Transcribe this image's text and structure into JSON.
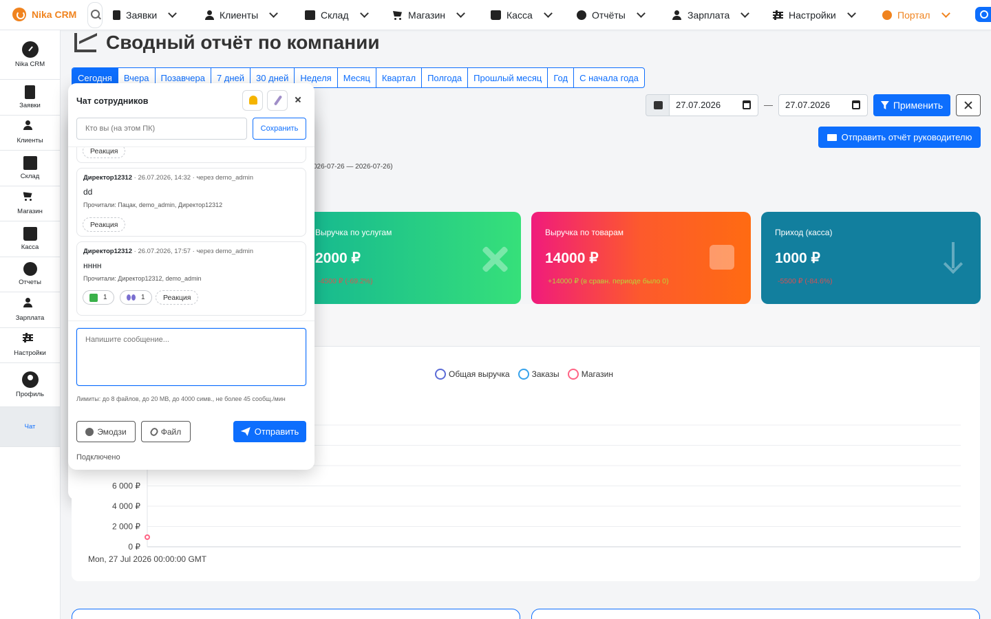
{
  "brand": {
    "name": "Nika CRM",
    "accent": "#f0831e"
  },
  "nav": [
    {
      "label": "Заявки",
      "icon": "document-icon"
    },
    {
      "label": "Клиенты",
      "icon": "users-icon"
    },
    {
      "label": "Склад",
      "icon": "boxes-icon"
    },
    {
      "label": "Магазин",
      "icon": "cart-icon"
    },
    {
      "label": "Касса",
      "icon": "cash-register-icon"
    },
    {
      "label": "Отчёты",
      "icon": "pie-chart-icon"
    },
    {
      "label": "Зарплата",
      "icon": "user-tie-icon"
    },
    {
      "label": "Настройки",
      "icon": "sliders-icon"
    },
    {
      "label": "Портал",
      "icon": "portal-icon"
    }
  ],
  "sidebar": [
    {
      "label": "Nika CRM",
      "icon": "dashboard-gauge-icon"
    },
    {
      "label": "Заявки",
      "icon": "document-icon"
    },
    {
      "label": "Клиенты",
      "icon": "users-icon"
    },
    {
      "label": "Склад",
      "icon": "boxes-icon"
    },
    {
      "label": "Магазин",
      "icon": "cart-icon"
    },
    {
      "label": "Касса",
      "icon": "cash-register-icon"
    },
    {
      "label": "Отчеты",
      "icon": "pie-chart-icon"
    },
    {
      "label": "Зарплата",
      "icon": "user-tie-icon"
    },
    {
      "label": "Настройки",
      "icon": "sliders-icon"
    },
    {
      "label": "Профиль",
      "icon": "avatar-icon"
    },
    {
      "label": "Чат",
      "icon": "chat-icon"
    }
  ],
  "page": {
    "title": "Сводный отчёт по компании"
  },
  "periods": [
    "Сегодня",
    "Вчера",
    "Позавчера",
    "7 дней",
    "30 дней",
    "Неделя",
    "Месяц",
    "Квартал",
    "Полгода",
    "Прошлый месяц",
    "Год",
    "С начала года"
  ],
  "filters": {
    "date_from": "27.07.2026",
    "date_to": "27.07.2026",
    "separator": "—",
    "apply": "Применить",
    "send_report": "Отправить отчёт руководителю",
    "range_note": "026-07-26 — 2026-07-26)"
  },
  "cards": [
    {
      "title": "Выручка по услугам",
      "value": "2000 ₽",
      "delta": "-4500 ₽ (-69.2%)",
      "icon": "tools-icon"
    },
    {
      "title": "Выручка по товарам",
      "value": "14000 ₽",
      "delta": "+14000 ₽ (в сравн. периоде было 0)",
      "icon": "shopping-bag-icon"
    },
    {
      "title": "Приход (касса)",
      "value": "1000 ₽",
      "delta": "-5500 ₽ (-84.6%)",
      "icon": "arrow-down-icon"
    }
  ],
  "chart_data": {
    "type": "line",
    "x": [
      "Mon, 27 Jul 2026 00:00:00 GMT"
    ],
    "series": [
      {
        "name": "Общая выручка",
        "color": "#5b6bd6",
        "values": [
          null
        ]
      },
      {
        "name": "Заказы",
        "color": "#36a2eb",
        "values": [
          null
        ]
      },
      {
        "name": "Магазин",
        "color": "#ff6384",
        "values": [
          0
        ]
      }
    ],
    "ytick_labels": [
      "6 000 ₽",
      "4 000 ₽",
      "2 000 ₽",
      "0 ₽"
    ],
    "yticks": [
      6000,
      4000,
      2000,
      0
    ],
    "ylim": [
      0,
      12000
    ],
    "grid": true,
    "legend": "top-center"
  },
  "chat": {
    "title": "Чат сотрудников",
    "who_placeholder": "Кто вы (на этом ПК)",
    "save": "Сохранить",
    "react": "Реакция",
    "messages": [
      {
        "author": "Директор12312",
        "meta": " · 26.07.2026, 14:32 · через demo_admin",
        "text": "dd",
        "read": "Прочитали: Пацак, demo_admin, Директор12312"
      },
      {
        "author": "Директор12312",
        "meta": " · 26.07.2026, 17:57 · через demo_admin",
        "text": "нннн",
        "read": "Прочитали: Директор12312, demo_admin",
        "reactions": [
          "1",
          "1"
        ]
      }
    ],
    "message_placeholder": "Напишите сообщение...",
    "limits": "Лимиты: до 8 файлов, до 20 MB, до 4000 симв., не более 45 сообщ./мин",
    "emoji": "Эмодзи",
    "file": "Файл",
    "send": "Отправить",
    "status": "Подключено"
  }
}
